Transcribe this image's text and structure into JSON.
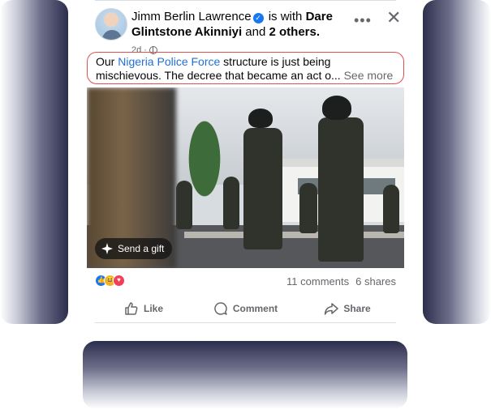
{
  "post": {
    "author": "Jimm Berlin Lawrence",
    "with_text": "is with",
    "tagged": "Dare Glintstone Akinniyi",
    "and_text": "and",
    "others": "2 others.",
    "time": "2d",
    "privacy_icon": "globe-icon",
    "text_prefix": "Our ",
    "text_link": "Nigeria Police Force",
    "text_rest": " structure is just being mischievous. The decree that became an act o...",
    "see_more": "See more",
    "gift_button": "Send a gift"
  },
  "stats": {
    "reactions": [
      "like",
      "haha",
      "love"
    ],
    "comments": "11 comments",
    "shares": "6 shares"
  },
  "actions": {
    "like": "Like",
    "comment": "Comment",
    "share": "Share"
  },
  "colors": {
    "link": "#216fdb",
    "highlight_border": "#e0504f",
    "meta_text": "#65676b"
  }
}
